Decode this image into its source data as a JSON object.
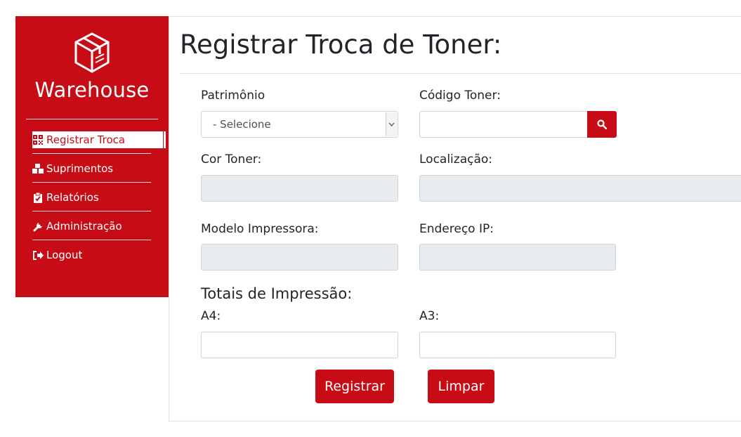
{
  "sidebar": {
    "brand": "Warehouse",
    "logo_icon": "box-package-icon",
    "items": [
      {
        "label": "Registrar Troca",
        "icon": "qrcode-icon",
        "active": true
      },
      {
        "label": "Suprimentos",
        "icon": "boxes-icon",
        "active": false
      },
      {
        "label": "Relatórios",
        "icon": "clipboard-check-icon",
        "active": false
      },
      {
        "label": "Administração",
        "icon": "wrench-icon",
        "active": false
      },
      {
        "label": "Logout",
        "icon": "sign-out-icon",
        "active": false
      }
    ]
  },
  "main": {
    "title": "Registrar Troca de Toner:",
    "fields": {
      "patrimonio": {
        "label": "Patrimônio",
        "selected": "- Selecione"
      },
      "codigo_toner": {
        "label": "Código Toner:",
        "value": ""
      },
      "cor_toner": {
        "label": "Cor Toner:",
        "value": ""
      },
      "localizacao": {
        "label": "Localização:",
        "value": ""
      },
      "modelo_impressora": {
        "label": "Modelo Impressora:",
        "value": ""
      },
      "endereco_ip": {
        "label": "Endereço IP:",
        "value": ""
      }
    },
    "totais": {
      "heading": "Totais de Impressão:",
      "a4": {
        "label": "A4:",
        "value": ""
      },
      "a3": {
        "label": "A3:",
        "value": ""
      }
    },
    "buttons": {
      "registrar": "Registrar",
      "limpar": "Limpar"
    }
  },
  "colors": {
    "accent": "#c80c16",
    "readonly_bg": "#e9ecef",
    "border": "#ced4da"
  }
}
